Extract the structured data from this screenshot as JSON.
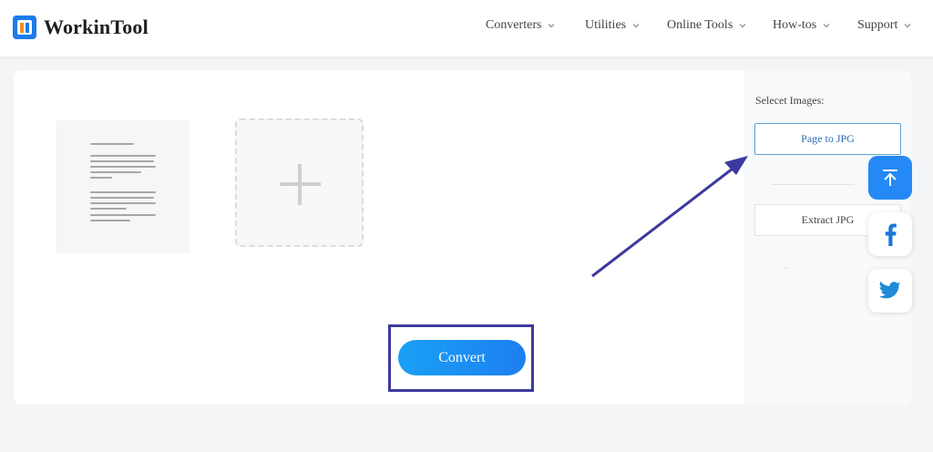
{
  "header": {
    "brand": "WorkinTool",
    "nav": [
      {
        "label": "Converters"
      },
      {
        "label": "Utilities"
      },
      {
        "label": "Online Tools"
      },
      {
        "label": "How-tos"
      },
      {
        "label": "Support"
      }
    ]
  },
  "main": {
    "convert_label": "Convert"
  },
  "side": {
    "title": "Selecet Images:",
    "options": [
      {
        "label": "Page to JPG",
        "active": true
      },
      {
        "label": "Extract JPG",
        "active": false
      }
    ]
  },
  "floating": {
    "icons": [
      "arrow-up-icon",
      "facebook-icon",
      "twitter-icon"
    ]
  },
  "colors": {
    "brand_blue": "#1d7be8",
    "convert_gradient_start": "#1aa0f5",
    "annotation": "#3c3a9e",
    "active_option_border": "#5ea3d8"
  }
}
